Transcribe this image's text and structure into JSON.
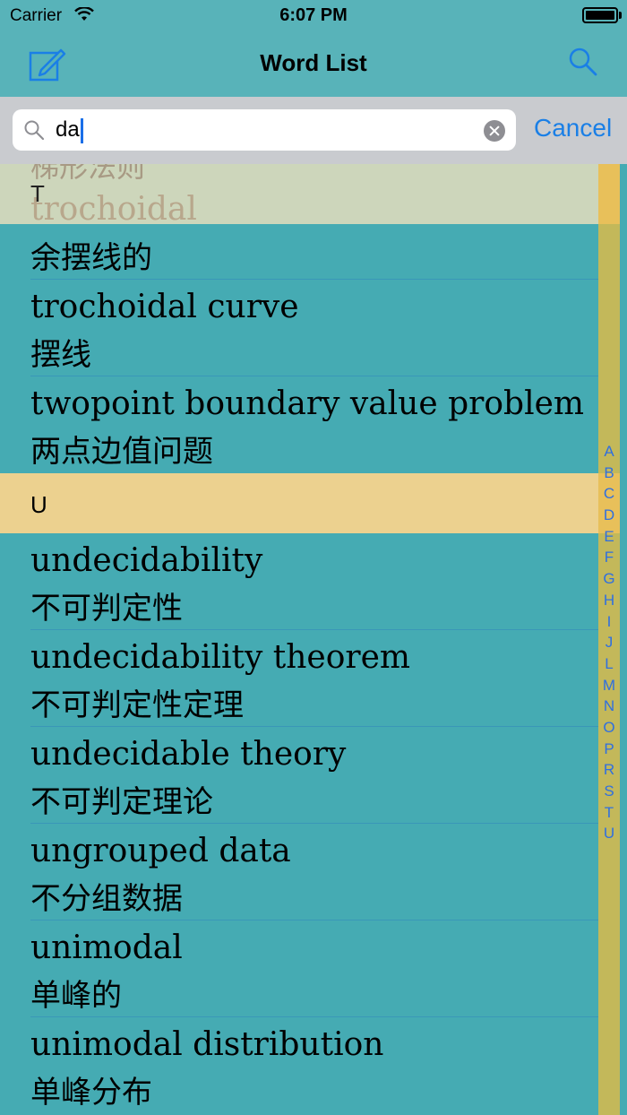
{
  "status": {
    "carrier": "Carrier",
    "time": "6:07 PM"
  },
  "nav": {
    "title": "Word List",
    "edit_icon": "compose-icon",
    "search_icon": "search-icon"
  },
  "search": {
    "value": "da",
    "cancel_label": "Cancel"
  },
  "faded": {
    "cn": "梯形法则",
    "section": "T",
    "word": "trochoidal"
  },
  "rows": [
    {
      "en": "",
      "cn": "余摆线的"
    },
    {
      "en": "trochoidal curve",
      "cn": "摆线"
    },
    {
      "en": "twopoint boundary value problem",
      "cn": "两点边值问题"
    },
    {
      "en": "undecidability",
      "cn": "不可判定性"
    },
    {
      "en": "undecidability theorem",
      "cn": "不可判定性定理"
    },
    {
      "en": "undecidable theory",
      "cn": "不可判定理论"
    },
    {
      "en": "ungrouped data",
      "cn": "不分组数据"
    },
    {
      "en": "unimodal",
      "cn": "单峰的"
    },
    {
      "en": "unimodal distribution",
      "cn": "单峰分布"
    }
  ],
  "section_u": "U",
  "index": [
    "A",
    "B",
    "C",
    "D",
    "E",
    "F",
    "G",
    "H",
    "I",
    "J",
    "L",
    "M",
    "N",
    "O",
    "P",
    "R",
    "S",
    "T",
    "U"
  ]
}
